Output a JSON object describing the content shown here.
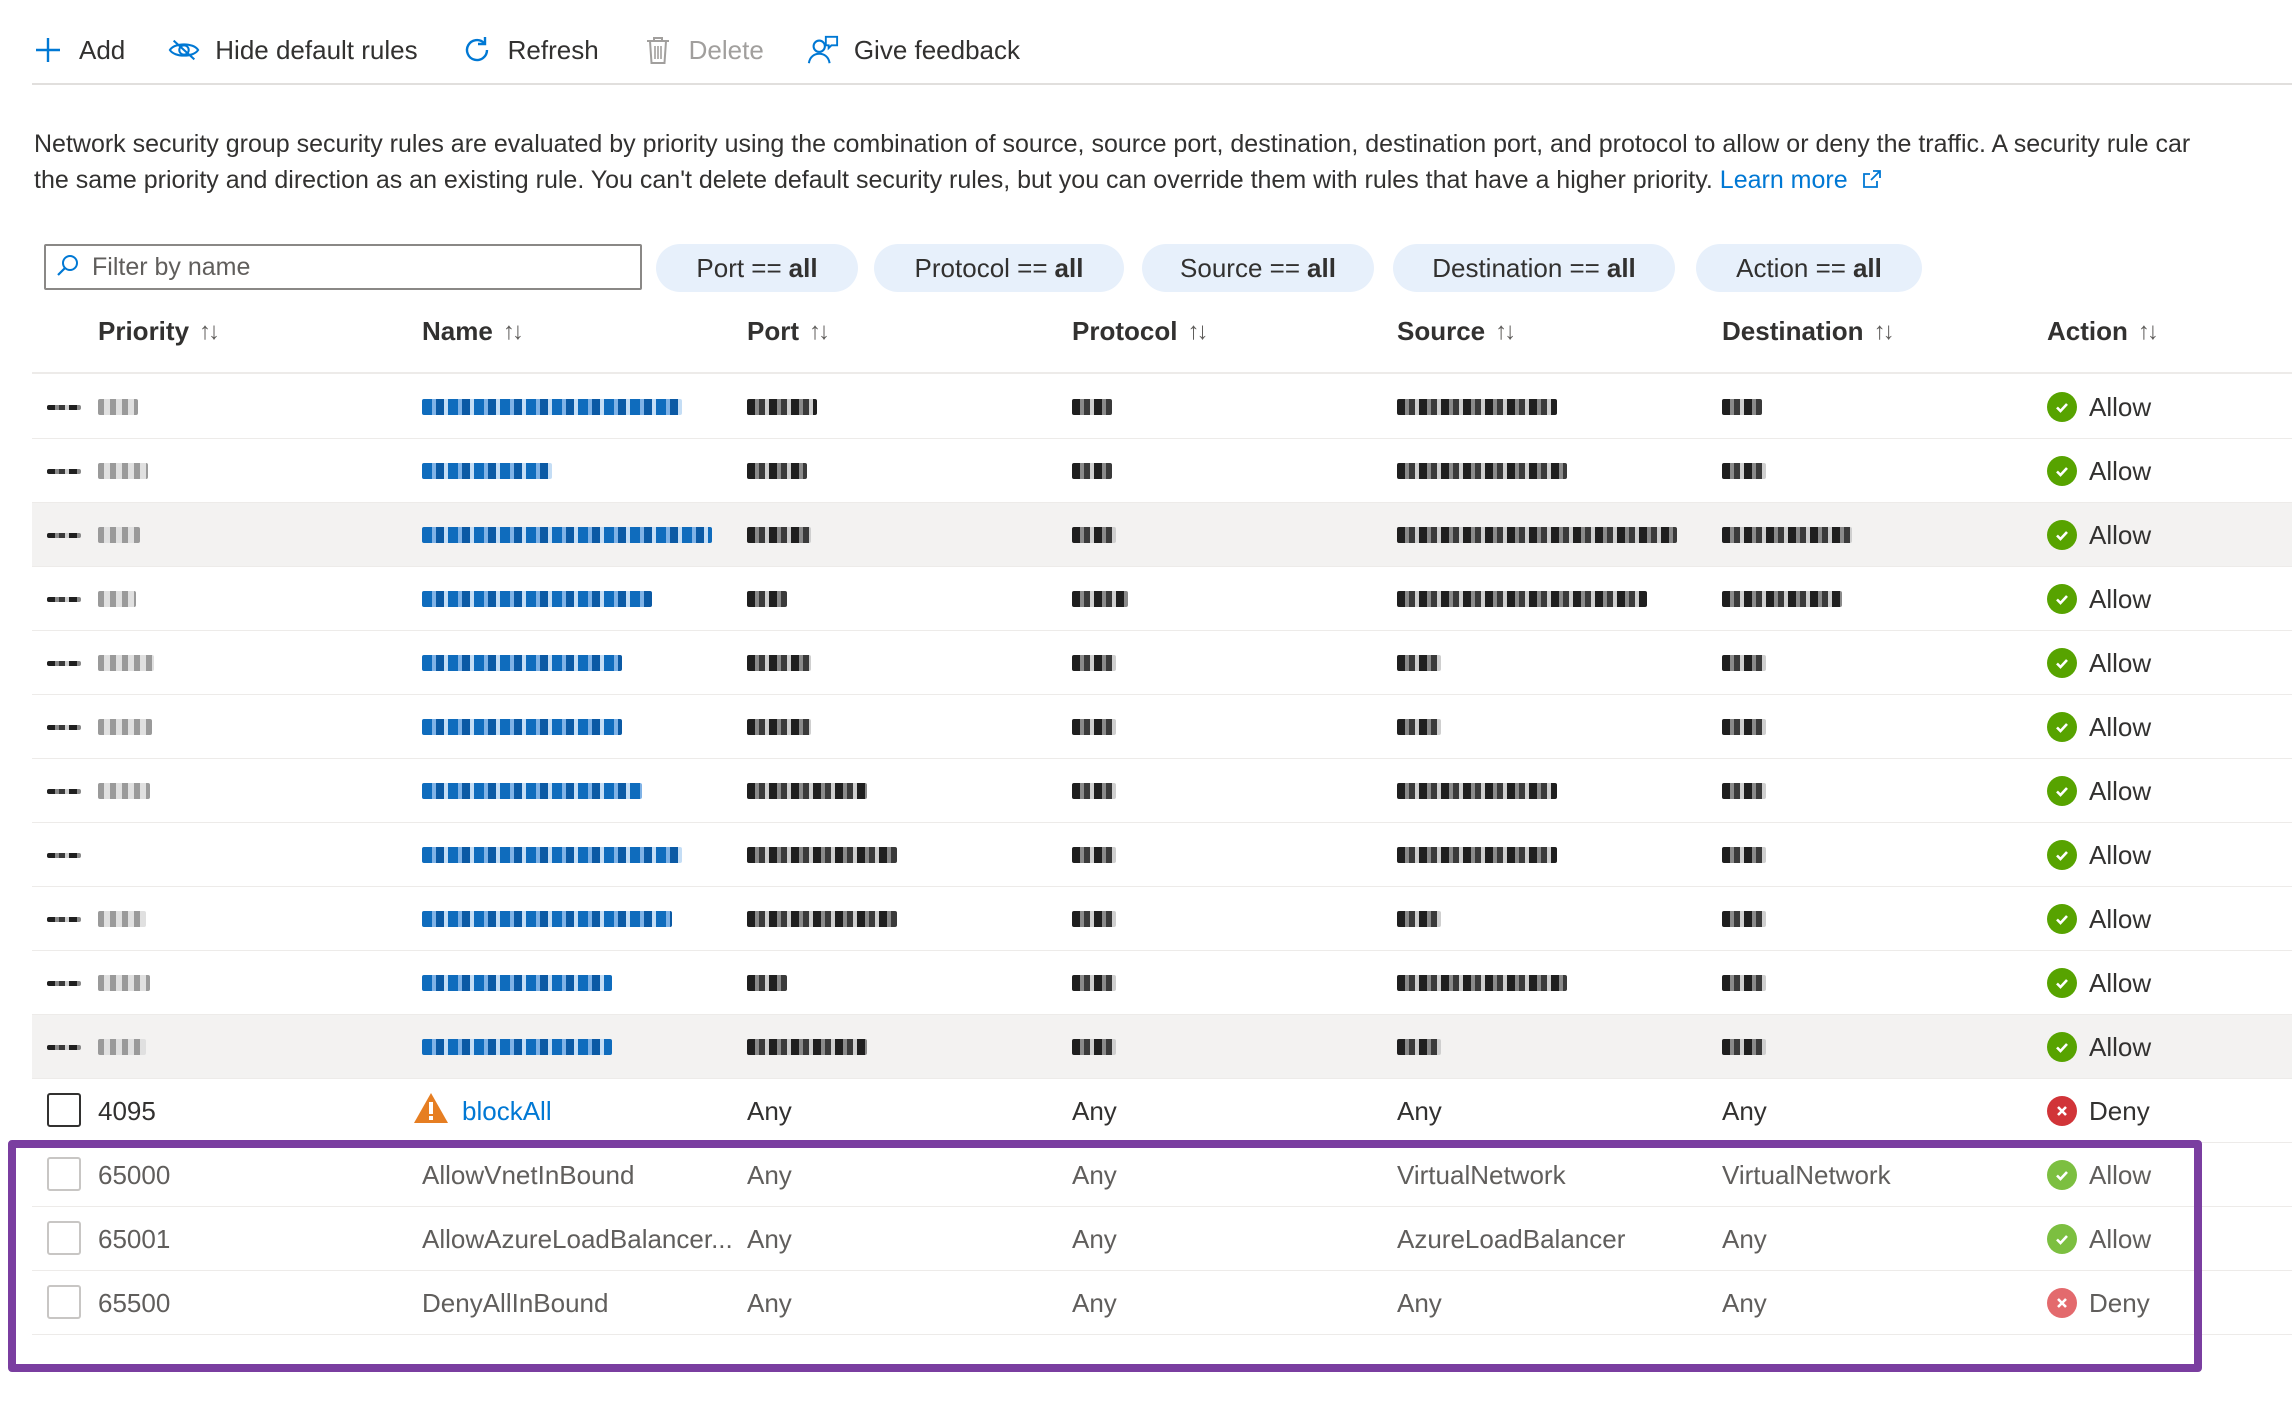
{
  "toolbar": {
    "add": "Add",
    "hide_default": "Hide default rules",
    "refresh": "Refresh",
    "delete": "Delete",
    "feedback": "Give feedback"
  },
  "description": {
    "line1": "Network security group security rules are evaluated by priority using the combination of source, source port, destination, destination port, and protocol to allow or deny the traffic. A security rule car",
    "line2": "the same priority and direction as an existing rule. You can't delete default security rules, but you can override them with rules that have a higher priority.",
    "learn_more": "Learn more"
  },
  "filters": {
    "placeholder": "Filter by name",
    "pills": [
      {
        "label": "Port ==",
        "value": "all"
      },
      {
        "label": "Protocol ==",
        "value": "all"
      },
      {
        "label": "Source ==",
        "value": "all"
      },
      {
        "label": "Destination ==",
        "value": "all"
      },
      {
        "label": "Action ==",
        "value": "all"
      }
    ]
  },
  "columns": {
    "priority": "Priority",
    "name": "Name",
    "port": "Port",
    "protocol": "Protocol",
    "source": "Source",
    "destination": "Destination",
    "action": "Action"
  },
  "redacted_rows": [
    {
      "action": "Allow",
      "shaded": false
    },
    {
      "action": "Allow",
      "shaded": false
    },
    {
      "action": "Allow",
      "shaded": true
    },
    {
      "action": "Allow",
      "shaded": false
    },
    {
      "action": "Allow",
      "shaded": false
    },
    {
      "action": "Allow",
      "shaded": false
    },
    {
      "action": "Allow",
      "shaded": false
    },
    {
      "action": "Allow",
      "shaded": false
    },
    {
      "action": "Allow",
      "shaded": false
    },
    {
      "action": "Allow",
      "shaded": false
    },
    {
      "action": "Allow",
      "shaded": true
    }
  ],
  "rows": [
    {
      "priority": "4095",
      "name": "blockAll",
      "port": "Any",
      "protocol": "Any",
      "source": "Any",
      "destination": "Any",
      "action": "Deny"
    },
    {
      "priority": "65000",
      "name": "AllowVnetInBound",
      "port": "Any",
      "protocol": "Any",
      "source": "VirtualNetwork",
      "destination": "VirtualNetwork",
      "action": "Allow"
    },
    {
      "priority": "65001",
      "name": "AllowAzureLoadBalancer...",
      "port": "Any",
      "protocol": "Any",
      "source": "AzureLoadBalancer",
      "destination": "Any",
      "action": "Allow"
    },
    {
      "priority": "65500",
      "name": "DenyAllInBound",
      "port": "Any",
      "protocol": "Any",
      "source": "Any",
      "destination": "Any",
      "action": "Deny"
    }
  ]
}
